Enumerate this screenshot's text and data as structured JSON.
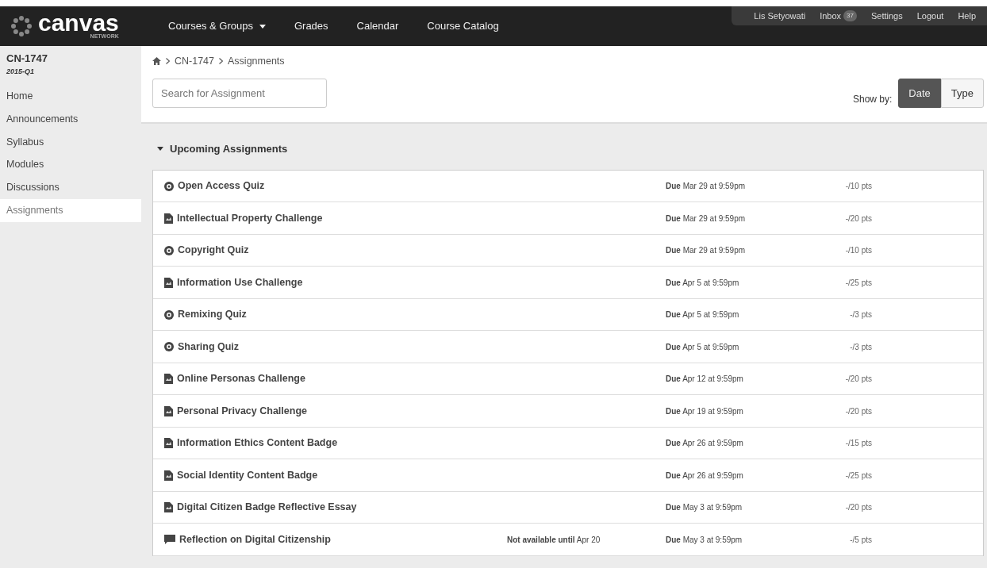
{
  "header": {
    "logo": {
      "name": "canvas",
      "sub": "NETWORK"
    },
    "nav": [
      {
        "label": "Courses & Groups",
        "dropdown": true
      },
      {
        "label": "Grades",
        "dropdown": false
      },
      {
        "label": "Calendar",
        "dropdown": false
      },
      {
        "label": "Course Catalog",
        "dropdown": false
      }
    ],
    "user_menu": [
      {
        "label": "Lis Setyowati"
      },
      {
        "label": "Inbox",
        "badge": "37"
      },
      {
        "label": "Settings"
      },
      {
        "label": "Logout"
      },
      {
        "label": "Help"
      }
    ]
  },
  "sidebar": {
    "course": "CN-1747",
    "term": "2015-Q1",
    "items": [
      {
        "label": "Home",
        "selected": false
      },
      {
        "label": "Announcements",
        "selected": false
      },
      {
        "label": "Syllabus",
        "selected": false
      },
      {
        "label": "Modules",
        "selected": false
      },
      {
        "label": "Discussions",
        "selected": false
      },
      {
        "label": "Assignments",
        "selected": true
      }
    ]
  },
  "breadcrumb": [
    "CN-1747",
    "Assignments"
  ],
  "search": {
    "placeholder": "Search for Assignment"
  },
  "show_by": {
    "label": "Show by:",
    "options": [
      {
        "label": "Date",
        "selected": true
      },
      {
        "label": "Type",
        "selected": false
      }
    ]
  },
  "group": {
    "title": "Upcoming Assignments",
    "expanded": true,
    "assignments": [
      {
        "kind": "quiz",
        "name": "Open Access Quiz",
        "due": "**Due** Mar 29 at 9:59pm",
        "points": "-/10 pts"
      },
      {
        "kind": "assignment",
        "name": "Intellectual Property Challenge",
        "due": "**Due** Mar 29 at 9:59pm",
        "points": "-/20 pts"
      },
      {
        "kind": "quiz",
        "name": "Copyright Quiz",
        "due": "**Due** Mar 29 at 9:59pm",
        "points": "-/10 pts"
      },
      {
        "kind": "assignment",
        "name": "Information Use Challenge",
        "due": "**Due** Apr 5 at 9:59pm",
        "points": "-/25 pts"
      },
      {
        "kind": "quiz",
        "name": "Remixing Quiz",
        "due": "**Due** Apr 5 at 9:59pm",
        "points": "-/3 pts"
      },
      {
        "kind": "quiz",
        "name": "Sharing Quiz",
        "due": "**Due** Apr 5 at 9:59pm",
        "points": "-/3 pts"
      },
      {
        "kind": "assignment",
        "name": "Online Personas Challenge",
        "due": "**Due** Apr 12 at 9:59pm",
        "points": "-/20 pts"
      },
      {
        "kind": "assignment",
        "name": "Personal Privacy Challenge",
        "due": "**Due** Apr 19 at 9:59pm",
        "points": "-/20 pts"
      },
      {
        "kind": "assignment",
        "name": "Information Ethics Content Badge",
        "due": "**Due** Apr 26 at 9:59pm",
        "points": "-/15 pts"
      },
      {
        "kind": "assignment",
        "name": "Social Identity Content Badge",
        "due": "**Due** Apr 26 at 9:59pm",
        "points": "-/25 pts"
      },
      {
        "kind": "assignment",
        "name": "Digital Citizen Badge Reflective Essay",
        "due": "**Due** May 3 at 9:59pm",
        "points": "-/20 pts"
      },
      {
        "kind": "discussion",
        "name": "Reflection on Digital Citizenship",
        "availability": "**Not available until** Apr 20",
        "due": "**Due** May 3 at 9:59pm",
        "points": "-/5 pts"
      }
    ]
  }
}
